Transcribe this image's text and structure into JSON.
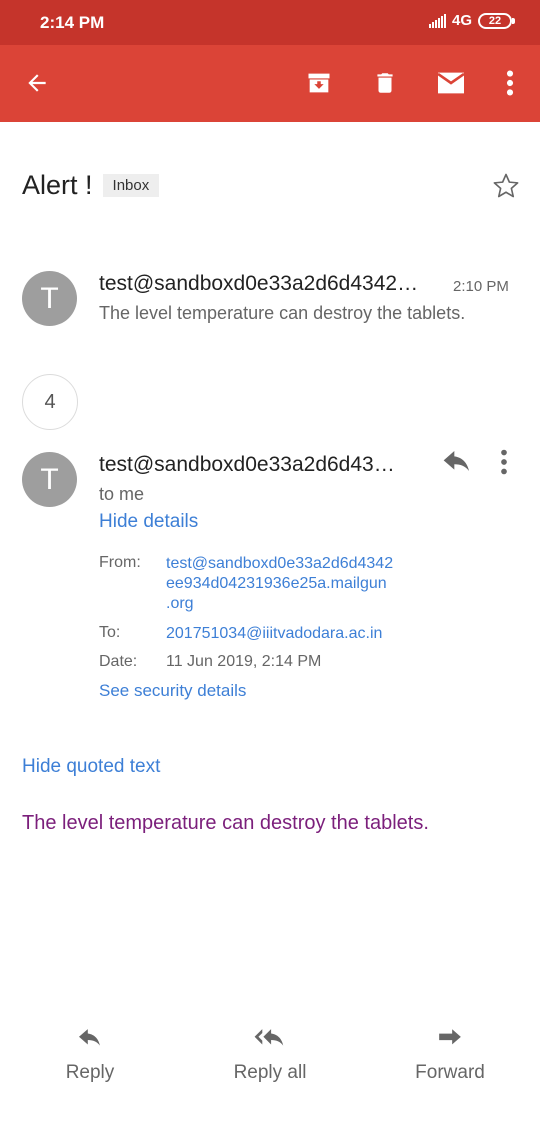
{
  "status_bar": {
    "time": "2:14 PM",
    "network": "4G",
    "battery": "22"
  },
  "toolbar": {
    "back_icon": "arrow-left-icon",
    "archive_icon": "archive-icon",
    "delete_icon": "trash-icon",
    "mark_unread_icon": "mail-icon",
    "more_icon": "more-vert-icon",
    "color": "#db4437"
  },
  "subject": {
    "title": "Alert !",
    "label": "Inbox"
  },
  "collapsed_message": {
    "avatar_letter": "T",
    "sender": "test@sandboxd0e33a2d6d4342…",
    "time": "2:10 PM",
    "snippet": "The level temperature can destroy the tablets."
  },
  "hidden_count": "4",
  "expanded_message": {
    "avatar_letter": "T",
    "sender": "test@sandboxd0e33a2d6d43…",
    "recipient_summary": "to me",
    "hide_details": "Hide details",
    "from_label": "From:",
    "from_lines": [
      "test@sandboxd0e33a2d6d4342",
      "ee934d04231936e25a.mailgun",
      ".org"
    ],
    "to_label": "To:",
    "to_value": "201751034@iiitvadodara.ac.in",
    "date_label": "Date:",
    "date_value": "11 Jun 2019, 2:14 PM",
    "security_link": "See security details",
    "hide_quoted": "Hide quoted text",
    "body": "The level temperature can destroy the tablets."
  },
  "bottom_actions": {
    "reply": "Reply",
    "reply_all": "Reply all",
    "forward": "Forward"
  }
}
